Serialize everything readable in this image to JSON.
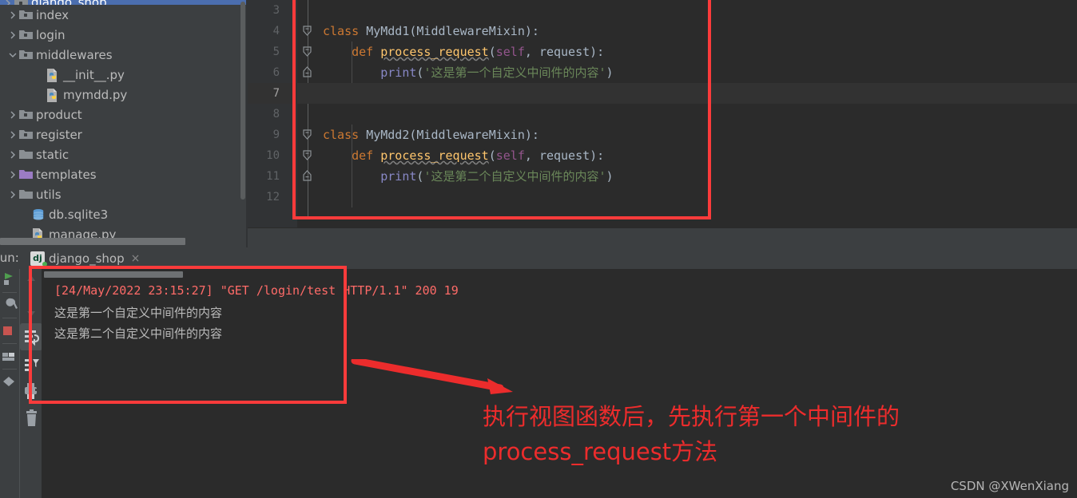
{
  "project_tree": {
    "rows": [
      {
        "label": "django_shop",
        "icon": "folder-module-icon",
        "arrow": "chevron-right",
        "depth": 0,
        "selected": true,
        "clipped_top": true
      },
      {
        "label": "index",
        "icon": "folder-module-icon",
        "arrow": "chevron-right",
        "depth": 1,
        "selected": false
      },
      {
        "label": "login",
        "icon": "folder-module-icon",
        "arrow": "chevron-right",
        "depth": 1,
        "selected": false
      },
      {
        "label": "middlewares",
        "icon": "folder-module-icon",
        "arrow": "chevron-down",
        "depth": 1,
        "selected": false
      },
      {
        "label": "__init__.py",
        "icon": "python-file-icon",
        "arrow": "none",
        "depth": 3,
        "selected": false
      },
      {
        "label": "mymdd.py",
        "icon": "python-file-icon",
        "arrow": "none",
        "depth": 3,
        "selected": false
      },
      {
        "label": "product",
        "icon": "folder-module-icon",
        "arrow": "chevron-right",
        "depth": 1,
        "selected": false
      },
      {
        "label": "register",
        "icon": "folder-module-icon",
        "arrow": "chevron-right",
        "depth": 1,
        "selected": false
      },
      {
        "label": "static",
        "icon": "folder-icon",
        "arrow": "chevron-right",
        "depth": 1,
        "selected": false
      },
      {
        "label": "templates",
        "icon": "folder-templates-icon",
        "arrow": "chevron-right",
        "depth": 1,
        "selected": false
      },
      {
        "label": "utils",
        "icon": "folder-icon",
        "arrow": "chevron-right",
        "depth": 1,
        "selected": false
      },
      {
        "label": "db.sqlite3",
        "icon": "database-icon",
        "arrow": "none",
        "depth": 2,
        "selected": false
      },
      {
        "label": "manage.py",
        "icon": "python-file-icon",
        "arrow": "none",
        "depth": 2,
        "selected": false
      }
    ]
  },
  "editor": {
    "lines": [
      {
        "num": "3",
        "current": false,
        "fold": "none",
        "tokens": []
      },
      {
        "num": "4",
        "current": false,
        "fold": "start",
        "tokens": [
          {
            "t": "class ",
            "c": "t-kw"
          },
          {
            "t": "MyMdd1",
            "c": "t-cls"
          },
          {
            "t": "(",
            "c": "t-punct"
          },
          {
            "t": "MiddlewareMixin",
            "c": "t-cls"
          },
          {
            "t": "):",
            "c": "t-punct"
          }
        ]
      },
      {
        "num": "5",
        "current": false,
        "fold": "mid",
        "tokens": [
          {
            "t": "    ",
            "c": "t-plain"
          },
          {
            "t": "def ",
            "c": "t-kw"
          },
          {
            "t": "process_request",
            "c": "t-fn"
          },
          {
            "t": "(",
            "c": "t-punct"
          },
          {
            "t": "self",
            "c": "t-self"
          },
          {
            "t": ", ",
            "c": "t-punct"
          },
          {
            "t": "request",
            "c": "t-param"
          },
          {
            "t": "):",
            "c": "t-punct"
          }
        ]
      },
      {
        "num": "6",
        "current": false,
        "fold": "end",
        "tokens": [
          {
            "t": "        ",
            "c": "t-plain"
          },
          {
            "t": "print",
            "c": "t-builtin"
          },
          {
            "t": "(",
            "c": "t-punct"
          },
          {
            "t": "'这是第一个自定义中间件的内容'",
            "c": "t-str"
          },
          {
            "t": ")",
            "c": "t-punct"
          }
        ]
      },
      {
        "num": "7",
        "current": true,
        "fold": "none",
        "tokens": []
      },
      {
        "num": "8",
        "current": false,
        "fold": "none",
        "tokens": []
      },
      {
        "num": "9",
        "current": false,
        "fold": "start",
        "tokens": [
          {
            "t": "class ",
            "c": "t-kw"
          },
          {
            "t": "MyMdd2",
            "c": "t-cls"
          },
          {
            "t": "(",
            "c": "t-punct"
          },
          {
            "t": "MiddlewareMixin",
            "c": "t-cls"
          },
          {
            "t": "):",
            "c": "t-punct"
          }
        ]
      },
      {
        "num": "10",
        "current": false,
        "fold": "mid",
        "tokens": [
          {
            "t": "    ",
            "c": "t-plain"
          },
          {
            "t": "def ",
            "c": "t-kw"
          },
          {
            "t": "process_request",
            "c": "t-fn"
          },
          {
            "t": "(",
            "c": "t-punct"
          },
          {
            "t": "self",
            "c": "t-self"
          },
          {
            "t": ", ",
            "c": "t-punct"
          },
          {
            "t": "request",
            "c": "t-param"
          },
          {
            "t": "):",
            "c": "t-punct"
          }
        ]
      },
      {
        "num": "11",
        "current": false,
        "fold": "end",
        "tokens": [
          {
            "t": "        ",
            "c": "t-plain"
          },
          {
            "t": "print",
            "c": "t-builtin"
          },
          {
            "t": "(",
            "c": "t-punct"
          },
          {
            "t": "'这是第二个自定义中间件的内容'",
            "c": "t-str"
          },
          {
            "t": ")",
            "c": "t-punct"
          }
        ]
      },
      {
        "num": "12",
        "current": false,
        "fold": "none",
        "tokens": []
      }
    ]
  },
  "run_panel": {
    "label": "Run:",
    "tab": {
      "title": "django_shop",
      "icon": "django-icon",
      "close": "×",
      "status": "running"
    },
    "toolbar_left": [
      {
        "name": "rerun-icon"
      },
      {
        "name": "settings-wrench-icon"
      },
      {
        "name": "stop-icon"
      },
      {
        "name": "layout-icon"
      },
      {
        "name": "pin-icon"
      }
    ],
    "toolbar_second": [
      {
        "name": "scroll-up-icon"
      },
      {
        "name": "scroll-down-icon"
      },
      {
        "name": "soft-wrap-icon",
        "active": true
      },
      {
        "name": "use-console-filter-icon"
      },
      {
        "name": "print-icon"
      },
      {
        "name": "clear-all-icon"
      }
    ],
    "console_lines": [
      {
        "text": "[24/May/2022 23:15:27] \"GET /login/test HTTP/1.1\" 200 19",
        "color": "red"
      },
      {
        "text": "这是第一个自定义中间件的内容",
        "color": "gray"
      },
      {
        "text": "这是第二个自定义中间件的内容",
        "color": "gray"
      }
    ]
  },
  "annotations": {
    "text": "执行视图函数后，先执行第一个中间件的\nprocess_request方法",
    "color": "#ec2c2c",
    "box_editor": "code-highlight-box",
    "box_console": "console-highlight-box",
    "arrow": "pointer-arrow"
  },
  "watermark": "CSDN @XWenXiang",
  "colors": {
    "ide_chrome": "#3c3f41",
    "editor_bg": "#2b2b2b",
    "gutter_bg": "#313335",
    "selection_blue": "#4b6eaf",
    "annotation_red": "#fb3b3b",
    "console_red": "#ff6b68",
    "text_gray": "#bbbbbb"
  }
}
